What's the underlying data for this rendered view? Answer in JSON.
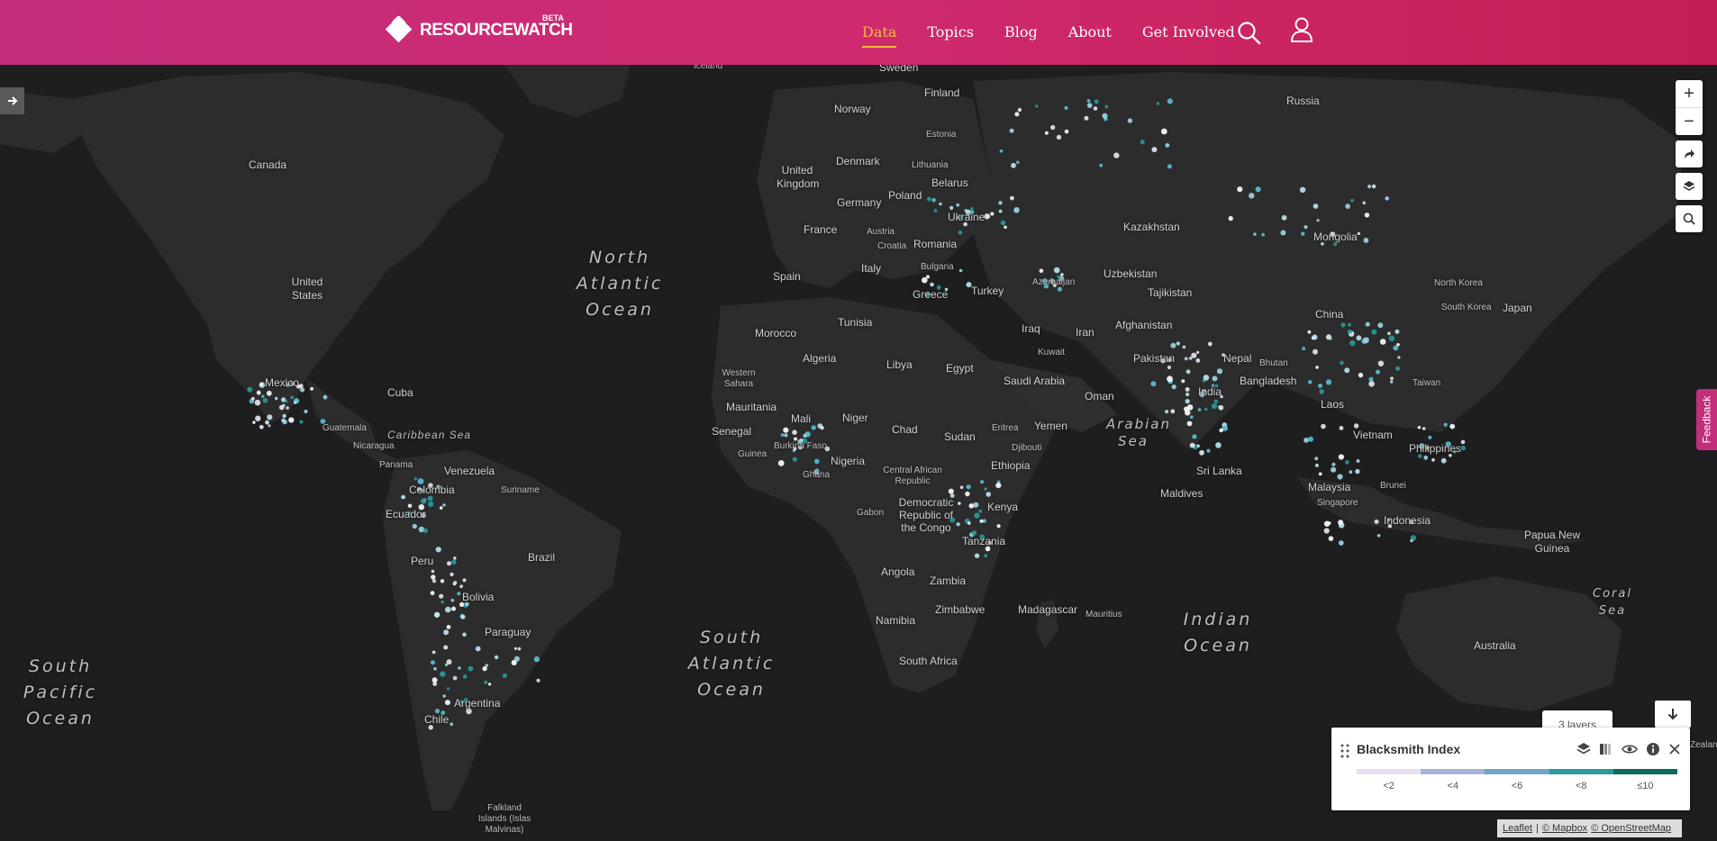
{
  "header": {
    "logo_text": "RESOURCEWATCH",
    "logo_badge": "BETA",
    "nav": [
      {
        "label": "Data",
        "active": true
      },
      {
        "label": "Topics",
        "active": false
      },
      {
        "label": "Blog",
        "active": false
      },
      {
        "label": "About",
        "active": false
      },
      {
        "label": "Get Involved",
        "active": false
      }
    ],
    "icons": [
      "search-icon",
      "user-icon"
    ]
  },
  "map_controls": {
    "zoom_in": "+",
    "zoom_out": "−",
    "icons": [
      "share-icon",
      "layers-icon",
      "search-icon"
    ]
  },
  "map_labels": {
    "countries": [
      "Iceland",
      "Sweden",
      "Finland",
      "Norway",
      "Russia",
      "Estonia",
      "Denmark",
      "Lithuania",
      "United Kingdom",
      "Belarus",
      "Poland",
      "Germany",
      "Ukraine",
      "France",
      "Austria",
      "Croatia",
      "Romania",
      "Kazakhstan",
      "Mongolia",
      "Bulgaria",
      "Italy",
      "Spain",
      "Greece",
      "Turkey",
      "Azerbaijan",
      "Uzbekistan",
      "Tajikistan",
      "North Korea",
      "South Korea",
      "Japan",
      "Canada",
      "United States",
      "Morocco",
      "Tunisia",
      "Algeria",
      "Libya",
      "Egypt",
      "Iraq",
      "Iran",
      "Afghanistan",
      "Kuwait",
      "China",
      "Pakistan",
      "Nepal",
      "Bhutan",
      "Bangladesh",
      "Saudi Arabia",
      "Western Sahara",
      "Mexico",
      "Cuba",
      "Mauritania",
      "Mali",
      "Niger",
      "Chad",
      "Sudan",
      "Eritrea",
      "Yemen",
      "Oman",
      "India",
      "Taiwan",
      "Laos",
      "Guatemala",
      "Nicaragua",
      "Senegal",
      "Burkina Faso",
      "Djibouti",
      "Philippines",
      "Vietnam",
      "Panama",
      "Venezuela",
      "Guinea",
      "Ghana",
      "Nigeria",
      "Ethiopia",
      "Sri Lanka",
      "Colombia",
      "Suriname",
      "Central African Republic",
      "Brunei",
      "Malaysia",
      "Maldives",
      "Singapore",
      "Ecuador",
      "Democratic Republic of the Congo",
      "Gabon",
      "Kenya",
      "Indonesia",
      "Papua New Guinea",
      "Tanzania",
      "Peru",
      "Brazil",
      "Angola",
      "Zambia",
      "Bolivia",
      "Zimbabwe",
      "Namibia",
      "Madagascar",
      "Mauritius",
      "Paraguay",
      "Australia",
      "South Africa",
      "Argentina",
      "Chile",
      "Falkland Islands (Islas Malvinas)",
      "Zealand"
    ],
    "oceans": [
      "North Atlantic Ocean",
      "Caribbean Sea",
      "Arabian Sea",
      "South Atlantic Ocean",
      "Indian Ocean",
      "South Pacific Ocean",
      "Coral Sea"
    ]
  },
  "legend": {
    "tooltip": "3 layers",
    "title": "Blacksmith Index",
    "bins": [
      {
        "label": "<2",
        "color": "#e8dff0"
      },
      {
        "label": "<4",
        "color": "#a8b4d6"
      },
      {
        "label": "<6",
        "color": "#6ea5c8"
      },
      {
        "label": "<8",
        "color": "#2a9a9a"
      },
      {
        "label": "≤10",
        "color": "#0c6b5a"
      }
    ],
    "tool_icons": [
      "layers-icon",
      "opacity-icon",
      "eye-icon",
      "info-icon",
      "close-icon"
    ]
  },
  "feedback_label": "Feedback",
  "attribution": {
    "leaflet": "Leaflet",
    "sep": "|",
    "mapbox": "© Mapbox",
    "osm": "© OpenStreetMap"
  }
}
